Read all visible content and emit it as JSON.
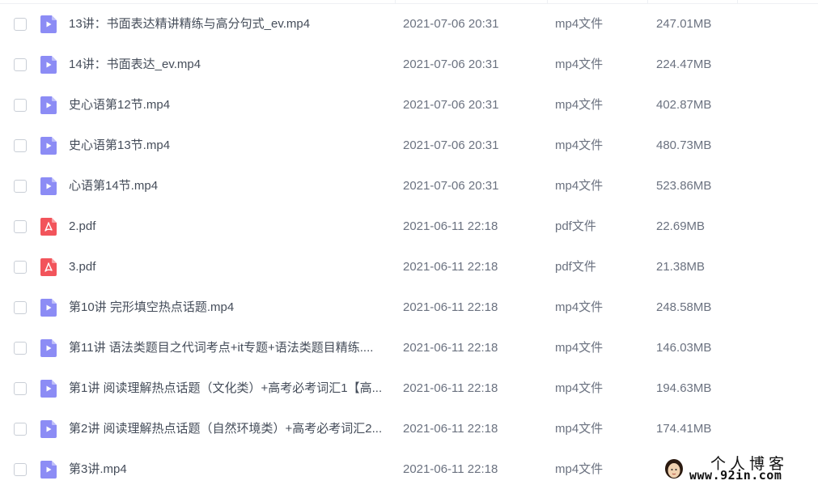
{
  "file_list": {
    "rows": [
      {
        "name": "13讲：书面表达精讲精练与高分句式_ev.mp4",
        "date": "2021-07-06 20:31",
        "type": "mp4文件",
        "size": "247.01MB",
        "icon": "video-file-icon"
      },
      {
        "name": "14讲：书面表达_ev.mp4",
        "date": "2021-07-06 20:31",
        "type": "mp4文件",
        "size": "224.47MB",
        "icon": "video-file-icon"
      },
      {
        "name": "史心语第12节.mp4",
        "date": "2021-07-06 20:31",
        "type": "mp4文件",
        "size": "402.87MB",
        "icon": "video-file-icon"
      },
      {
        "name": "史心语第13节.mp4",
        "date": "2021-07-06 20:31",
        "type": "mp4文件",
        "size": "480.73MB",
        "icon": "video-file-icon"
      },
      {
        "name": "心语第14节.mp4",
        "date": "2021-07-06 20:31",
        "type": "mp4文件",
        "size": "523.86MB",
        "icon": "video-file-icon"
      },
      {
        "name": "2.pdf",
        "date": "2021-06-11 22:18",
        "type": "pdf文件",
        "size": "22.69MB",
        "icon": "pdf-file-icon"
      },
      {
        "name": "3.pdf",
        "date": "2021-06-11 22:18",
        "type": "pdf文件",
        "size": "21.38MB",
        "icon": "pdf-file-icon"
      },
      {
        "name": "第10讲 完形填空热点话题.mp4",
        "date": "2021-06-11 22:18",
        "type": "mp4文件",
        "size": "248.58MB",
        "icon": "video-file-icon"
      },
      {
        "name": "第11讲 语法类题目之代词考点+it专题+语法类题目精练....",
        "date": "2021-06-11 22:18",
        "type": "mp4文件",
        "size": "146.03MB",
        "icon": "video-file-icon"
      },
      {
        "name": "第1讲 阅读理解热点话题（文化类）+高考必考词汇1【高...",
        "date": "2021-06-11 22:18",
        "type": "mp4文件",
        "size": "194.63MB",
        "icon": "video-file-icon"
      },
      {
        "name": "第2讲 阅读理解热点话题（自然环境类）+高考必考词汇2...",
        "date": "2021-06-11 22:18",
        "type": "mp4文件",
        "size": "174.41MB",
        "icon": "video-file-icon"
      },
      {
        "name": "第3讲.mp4",
        "date": "2021-06-11 22:18",
        "type": "mp4文件",
        "size": "",
        "icon": "video-file-icon"
      }
    ]
  },
  "watermark": {
    "title": "个人博客",
    "url": "www.92in.com"
  },
  "colors": {
    "video_icon": "#8c8cf5",
    "pdf_icon": "#f2545b",
    "text_primary": "#454d5a",
    "text_secondary": "#6b7280",
    "checkbox_border": "#c9ced6"
  }
}
